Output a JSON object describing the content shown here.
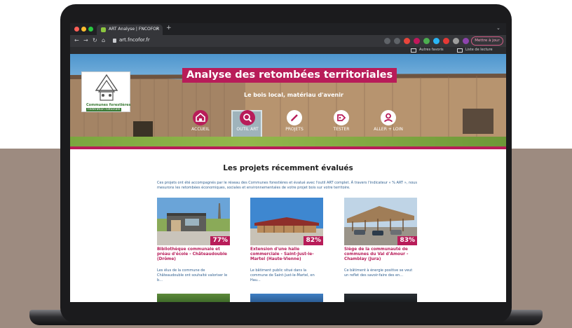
{
  "browser": {
    "tab_title": "ART Analyse | FNCOFOR",
    "tab_close": "×",
    "new_tab": "+",
    "tabbar_chevron": "⌄",
    "nav": {
      "back": "←",
      "forward": "→",
      "reload": "↻",
      "home": "⌂"
    },
    "url": "art.fncofor.fr",
    "update_button": "Mettre à jour",
    "bookmarks": {
      "other": "Autres favoris",
      "reading": "Liste de lecture"
    }
  },
  "hero": {
    "logo_line1": "Communes forestières",
    "logo_line2": "Fédération nationale",
    "title": "Analyse des retombées territoriales",
    "subtitle": "Le bois local, matériau d'avenir",
    "nav": [
      {
        "label": "ACCUEIL",
        "icon": "home-icon"
      },
      {
        "label": "OUTIL ART",
        "icon": "search-icon"
      },
      {
        "label": "PROJETS",
        "icon": "pencil-icon"
      },
      {
        "label": "TESTER",
        "icon": "tag-icon"
      },
      {
        "label": "ALLER + LOIN",
        "icon": "user-icon"
      }
    ]
  },
  "main": {
    "section_title": "Les projets récemment évalués",
    "intro": "Ces projets ont été accompagnés par le réseau des Communes forestières et évalué avec l'outil ART complet. À travers l'indicateur « % ART », nous mesurons les retombées économiques, sociales et environnementales de votre projet bois sur votre territoire.",
    "cards": [
      {
        "percent": "77%",
        "title": "Bibliothèque communale et préau d'école - Châteaudouble (Drôme)",
        "text": "Les élus de la commune de Châteaudouble ont souhaité valoriser le b..."
      },
      {
        "percent": "82%",
        "title": "Extension d'une halle commerciale - Saint-Just-le-Martel (Haute-Vienne)",
        "text": "Le bâtiment public situé dans la commune de Saint-Just-le-Martel, en Hau..."
      },
      {
        "percent": "83%",
        "title": "Siège de la communauté de communes du Val d'Amour - Chamblay (Jura)",
        "text": "Ce bâtiment à énergie positive se veut un reflet des savoir-faire des en..."
      }
    ]
  },
  "colors": {
    "accent": "#b81c59",
    "link_text": "#2f5f8f",
    "browser_dark": "#202124"
  }
}
